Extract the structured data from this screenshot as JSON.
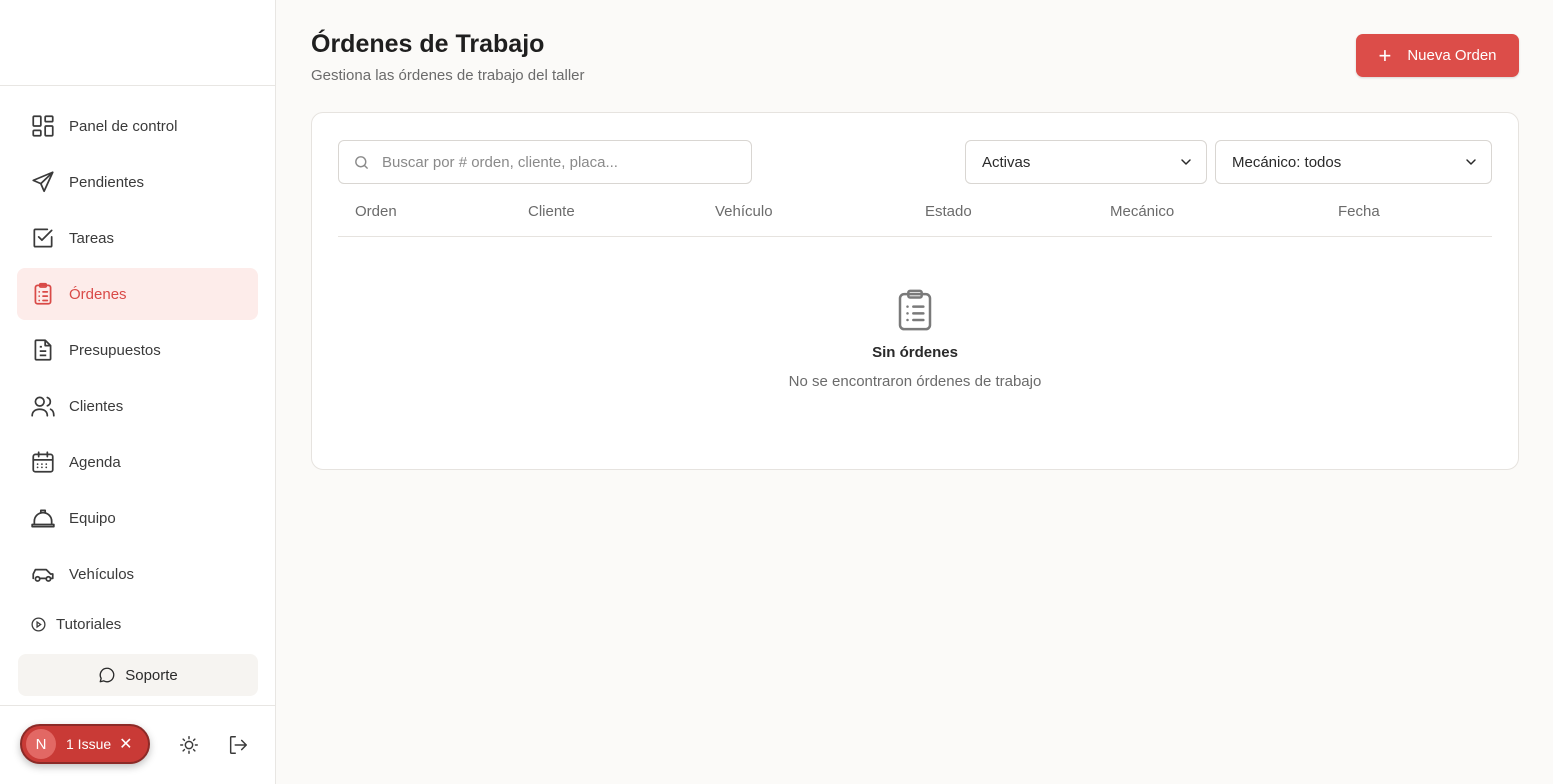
{
  "sidebar": {
    "items": [
      {
        "label": "Panel de control",
        "icon": "dashboard-icon"
      },
      {
        "label": "Pendientes",
        "icon": "send-icon"
      },
      {
        "label": "Tareas",
        "icon": "checkbox-icon"
      },
      {
        "label": "Órdenes",
        "icon": "clipboard-list-icon",
        "active": true
      },
      {
        "label": "Presupuestos",
        "icon": "document-icon"
      },
      {
        "label": "Clientes",
        "icon": "users-icon"
      },
      {
        "label": "Agenda",
        "icon": "calendar-icon"
      },
      {
        "label": "Equipo",
        "icon": "hard-hat-icon"
      },
      {
        "label": "Vehículos",
        "icon": "car-icon"
      }
    ],
    "tutorials_label": "Tutoriales",
    "support_label": "Soporte",
    "issue": {
      "avatar_letter": "N",
      "label": "1 Issue"
    }
  },
  "header": {
    "title": "Órdenes de Trabajo",
    "subtitle": "Gestiona las órdenes de trabajo del taller",
    "new_button": "Nueva Orden"
  },
  "filters": {
    "search_placeholder": "Buscar por # orden, cliente, placa...",
    "status_value": "Activas",
    "mechanic_value": "Mecánico: todos"
  },
  "table": {
    "columns": [
      "Orden",
      "Cliente",
      "Vehículo",
      "Estado",
      "Mecánico",
      "Fecha"
    ],
    "empty_title": "Sin órdenes",
    "empty_desc": "No se encontraron órdenes de trabajo"
  },
  "colors": {
    "accent": "#dc4d49",
    "active_bg": "#fdecea",
    "background": "#fbfaf8"
  }
}
